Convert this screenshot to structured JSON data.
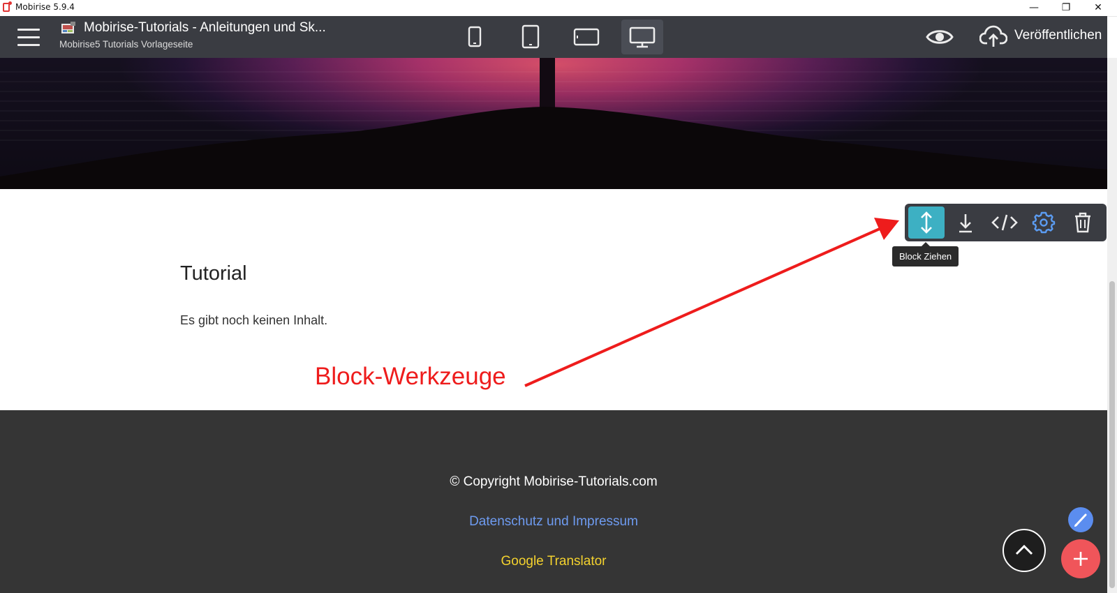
{
  "window": {
    "title": "Mobirise 5.9.4",
    "controls": {
      "minimize": "—",
      "restore": "❐",
      "close": "✕"
    }
  },
  "header": {
    "project_title": "Mobirise-Tutorials - Anleitungen und Sk...",
    "project_subtitle": "Mobirise5 Tutorials Vorlageseite",
    "devices": [
      {
        "name": "phone-portrait",
        "icon": "phone-icon",
        "active": false
      },
      {
        "name": "tablet-portrait",
        "icon": "tablet-icon",
        "active": false
      },
      {
        "name": "tablet-landscape",
        "icon": "tablet-landscape-icon",
        "active": false
      },
      {
        "name": "desktop",
        "icon": "desktop-icon",
        "active": true
      }
    ],
    "preview_icon": "eye-icon",
    "publish_label": "Veröffentlichen",
    "publish_icon": "cloud-upload-icon"
  },
  "block": {
    "title": "Tutorial",
    "text": "Es gibt noch keinen Inhalt."
  },
  "block_toolbar": {
    "buttons": [
      {
        "name": "drag",
        "icon": "drag-vertical-icon",
        "active": true
      },
      {
        "name": "download",
        "icon": "download-icon",
        "active": false
      },
      {
        "name": "code",
        "icon": "code-icon",
        "active": false
      },
      {
        "name": "settings",
        "icon": "gear-icon",
        "active": false
      },
      {
        "name": "delete",
        "icon": "trash-icon",
        "active": false
      }
    ],
    "tooltip": "Block Ziehen"
  },
  "annotation": {
    "label": "Block-Werkzeuge",
    "color": "#ee1c1c"
  },
  "footer": {
    "copyright": "© Copyright Mobirise-Tutorials.com",
    "privacy_link": "Datenschutz und Impressum",
    "translator_link": "Google Translator"
  },
  "fabs": {
    "scroll_top_icon": "chevron-up-icon",
    "edit_icon": "brush-icon",
    "add_icon": "plus-icon"
  },
  "colors": {
    "topbar": "#3a3c42",
    "accent_active": "#3db0c3",
    "footer_bg": "#353535",
    "link_blue": "#6e9bf0",
    "link_yellow": "#f4d22e",
    "add_fab": "#f0555a",
    "edit_fab": "#5b8def"
  }
}
